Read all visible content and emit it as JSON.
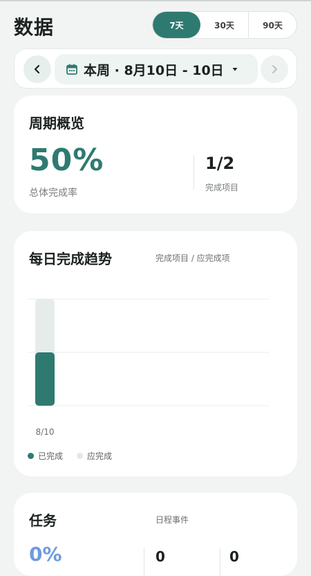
{
  "header": {
    "title": "数据",
    "ranges": [
      {
        "label": "7天",
        "active": true
      },
      {
        "label": "30天",
        "active": false
      },
      {
        "label": "90天",
        "active": false
      }
    ]
  },
  "date_nav": {
    "prev_icon": "chevron-left-icon",
    "calendar_icon": "calendar-icon",
    "label": "本周 · 8月10日 - 10日",
    "caret_icon": "caret-down-icon",
    "next_icon": "chevron-right-icon"
  },
  "overview": {
    "title": "周期概览",
    "completion_rate": "50%",
    "completion_rate_label": "总体完成率",
    "completed_ratio": "1/2",
    "completed_ratio_label": "完成项目"
  },
  "trend": {
    "title": "每日完成趋势",
    "subtitle": "完成项目 / 应完成项",
    "legend": [
      {
        "label": "已完成",
        "color": "#2e7a71"
      },
      {
        "label": "应完成",
        "color": "#e3e8e6"
      }
    ]
  },
  "chart_data": {
    "type": "bar",
    "categories": [
      "8/10"
    ],
    "series": [
      {
        "name": "已完成",
        "values": [
          1
        ]
      },
      {
        "name": "应完成",
        "values": [
          2
        ]
      }
    ],
    "ylim": [
      0,
      2
    ],
    "grid": true,
    "legend_position": "bottom-left",
    "colors": {
      "completed": "#2e7a71",
      "expected": "#e6ecea"
    }
  },
  "tasks": {
    "title": "任务",
    "subtitle": "日程事件",
    "pct": "0%",
    "num1": "0",
    "num2": "0"
  },
  "colors": {
    "accent": "#2e7a71",
    "background": "#f2f4f3",
    "card": "#ffffff"
  }
}
